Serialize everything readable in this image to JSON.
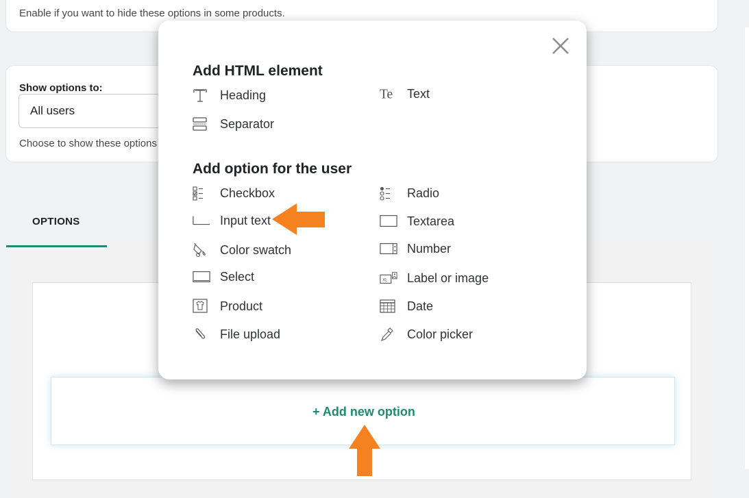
{
  "top_card": {
    "help": "Enable if you want to hide these options in some products."
  },
  "show_options": {
    "label": "Show options to:",
    "selected": "All users",
    "help": "Choose to show these options"
  },
  "tabs": [
    {
      "label": "OPTIONS",
      "active": true
    }
  ],
  "add_new_option": "+ Add new option",
  "modal": {
    "html_section_title": "Add HTML element",
    "html_items": [
      {
        "label": "Heading",
        "icon": "heading-icon"
      },
      {
        "label": "Text",
        "icon": "text-icon"
      },
      {
        "label": "Separator",
        "icon": "separator-icon"
      }
    ],
    "user_section_title": "Add option for the user",
    "user_items": [
      {
        "label": "Checkbox",
        "icon": "checkbox-icon"
      },
      {
        "label": "Radio",
        "icon": "radio-icon"
      },
      {
        "label": "Input text",
        "icon": "input-text-icon"
      },
      {
        "label": "Textarea",
        "icon": "textarea-icon"
      },
      {
        "label": "Color swatch",
        "icon": "color-swatch-icon"
      },
      {
        "label": "Number",
        "icon": "number-icon"
      },
      {
        "label": "Select",
        "icon": "select-icon"
      },
      {
        "label": "Label or image",
        "icon": "label-image-icon"
      },
      {
        "label": "Product",
        "icon": "product-icon"
      },
      {
        "label": "Date",
        "icon": "date-icon"
      },
      {
        "label": "File upload",
        "icon": "file-upload-icon"
      },
      {
        "label": "Color picker",
        "icon": "color-picker-icon"
      }
    ]
  },
  "colors": {
    "accent": "#1f8a70",
    "annotation_arrow": "#f58220"
  }
}
